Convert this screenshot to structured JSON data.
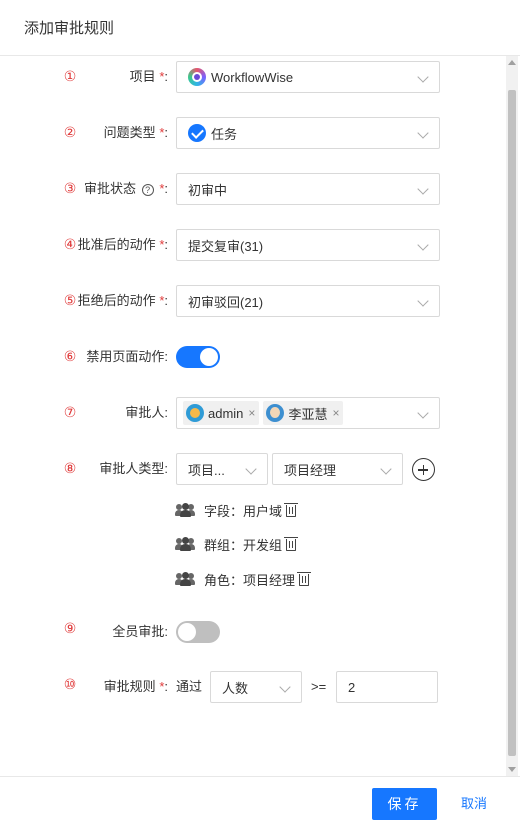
{
  "dialog": {
    "title": "添加审批规则"
  },
  "fields": {
    "project": {
      "num": "①",
      "label": "项目",
      "req": "*",
      "colon": ":",
      "value": "WorkflowWise"
    },
    "issue_type": {
      "num": "②",
      "label": "问题类型",
      "req": "*",
      "colon": ":",
      "value": "任务"
    },
    "approval_status": {
      "num": "③",
      "label": "审批状态",
      "help": "?",
      "req": "*",
      "colon": ":",
      "value": "初审中"
    },
    "action_after_approve": {
      "num": "④",
      "label": "批准后的动作",
      "req": "*",
      "colon": ":",
      "value": "提交复审(31)"
    },
    "action_after_reject": {
      "num": "⑤",
      "label": "拒绝后的动作",
      "req": "*",
      "colon": ":",
      "value": "初审驳回(21)"
    },
    "disable_page_action": {
      "num": "⑥",
      "label": "禁用页面动作:",
      "on": true
    },
    "approvers": {
      "num": "⑦",
      "label": "审批人:",
      "tags": [
        {
          "name": "admin",
          "close": "×"
        },
        {
          "name": "李亚慧",
          "close": "×"
        }
      ]
    },
    "approver_type": {
      "num": "⑧",
      "label": "审批人类型:",
      "select1": "项目...",
      "select2": "项目经理",
      "items": [
        "字段：用户域",
        "群组：开发组",
        "角色：项目经理"
      ]
    },
    "all_approve": {
      "num": "⑨",
      "label": "全员审批:",
      "on": false
    },
    "approval_rule": {
      "num": "⑩",
      "label": "审批规则",
      "req": "*",
      "colon": ":",
      "prefix": "通过",
      "mode": "人数",
      "op": ">=",
      "count": "2"
    }
  },
  "footer": {
    "save": "保存",
    "cancel": "取消"
  }
}
